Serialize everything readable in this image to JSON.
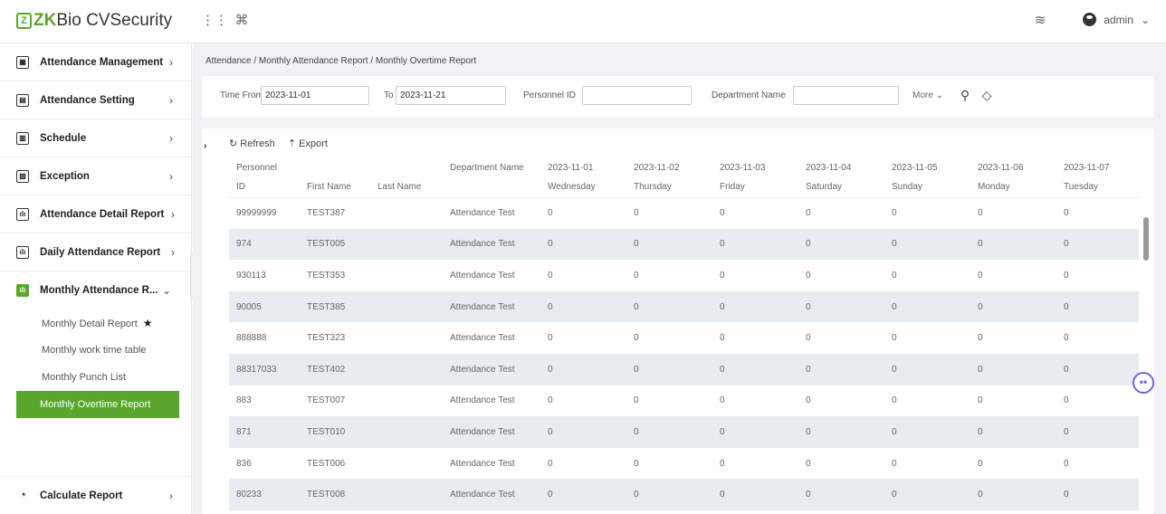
{
  "app": {
    "logo_prefix": "ZK",
    "logo_rest": "Bio CVSecurity",
    "user": "admin"
  },
  "sidebar": {
    "items": [
      {
        "label": "Attendance Management",
        "icon": "calendar-icon"
      },
      {
        "label": "Attendance Setting",
        "icon": "settings-icon"
      },
      {
        "label": "Schedule",
        "icon": "schedule-icon"
      },
      {
        "label": "Exception",
        "icon": "exception-icon"
      },
      {
        "label": "Attendance Detail Report",
        "icon": "report-icon"
      },
      {
        "label": "Daily Attendance Report",
        "icon": "report-icon"
      },
      {
        "label": "Monthly Attendance R...",
        "icon": "report-icon"
      }
    ],
    "subitems": [
      "Monthly Detail Report",
      "Monthly work time table",
      "Monthly Punch List",
      "Monthly Overtime Report"
    ],
    "bottom": {
      "label": "Calculate Report",
      "icon": "calculator-icon"
    }
  },
  "breadcrumb": "Attendance / Monthly Attendance Report / Monthly Overtime Report",
  "filter": {
    "time_from_label": "Time From",
    "time_from_value": "2023-11-01",
    "to_label": "To",
    "to_value": "2023-11-21",
    "personnel_id_label": "Personnel ID",
    "department_label": "Department Name",
    "more_label": "More"
  },
  "toolbar": {
    "refresh": "Refresh",
    "export": "Export"
  },
  "table": {
    "group_header": "Personnel",
    "headers": [
      "ID",
      "First Name",
      "Last Name",
      "Department Name"
    ],
    "dates": [
      "2023-11-01",
      "2023-11-02",
      "2023-11-03",
      "2023-11-04",
      "2023-11-05",
      "2023-11-06",
      "2023-11-07"
    ],
    "weekdays": [
      "Wednesday",
      "Thursday",
      "Friday",
      "Saturday",
      "Sunday",
      "Monday",
      "Tuesday"
    ],
    "rows": [
      [
        "99999999",
        "TEST387",
        "",
        "Attendance Test",
        "0",
        "0",
        "0",
        "0",
        "0",
        "0",
        "0"
      ],
      [
        "974",
        "TEST005",
        "",
        "Attendance Test",
        "0",
        "0",
        "0",
        "0",
        "0",
        "0",
        "0"
      ],
      [
        "930113",
        "TEST353",
        "",
        "Attendance Test",
        "0",
        "0",
        "0",
        "0",
        "0",
        "0",
        "0"
      ],
      [
        "90005",
        "TEST385",
        "",
        "Attendance Test",
        "0",
        "0",
        "0",
        "0",
        "0",
        "0",
        "0"
      ],
      [
        "888888",
        "TEST323",
        "",
        "Attendance Test",
        "0",
        "0",
        "0",
        "0",
        "0",
        "0",
        "0"
      ],
      [
        "88317033",
        "TEST402",
        "",
        "Attendance Test",
        "0",
        "0",
        "0",
        "0",
        "0",
        "0",
        "0"
      ],
      [
        "883",
        "TEST007",
        "",
        "Attendance Test",
        "0",
        "0",
        "0",
        "0",
        "0",
        "0",
        "0"
      ],
      [
        "871",
        "TEST010",
        "",
        "Attendance Test",
        "0",
        "0",
        "0",
        "0",
        "0",
        "0",
        "0"
      ],
      [
        "836",
        "TEST006",
        "",
        "Attendance Test",
        "0",
        "0",
        "0",
        "0",
        "0",
        "0",
        "0"
      ],
      [
        "80233",
        "TEST008",
        "",
        "Attendance Test",
        "0",
        "0",
        "0",
        "0",
        "0",
        "0",
        "0"
      ]
    ]
  }
}
